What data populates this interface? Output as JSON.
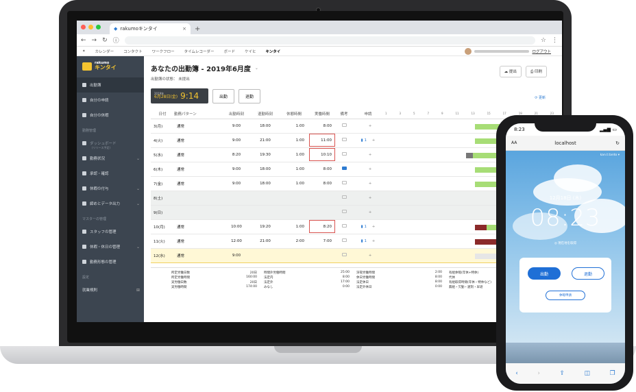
{
  "browser": {
    "tab_title": "rakumoキンタイ",
    "new_tab": "+",
    "tab_close": "×"
  },
  "bookmarks": {
    "items": [
      "カレンダー",
      "コンタクト",
      "ワークフロー",
      "タイムレコーダー",
      "ボード",
      "ケイヒ",
      "キンタイ"
    ],
    "logout": "ログアウト"
  },
  "sidebar": {
    "logo_top": "rakumo",
    "logo_main": "キンタイ",
    "items": [
      {
        "label": "出勤簿"
      },
      {
        "label": "自分の申請"
      },
      {
        "label": "自分の休暇"
      }
    ],
    "section_admin": "勤務管理",
    "admin_items": [
      {
        "label": "ダッシュボード"
      },
      {
        "label": "勤務状況"
      },
      {
        "label": "承認・確認"
      },
      {
        "label": "休暇の付与"
      },
      {
        "label": "締めとデータ出力"
      }
    ],
    "dashboard_sub": "(リリース予定)",
    "section_master": "マスターの管理",
    "master_items": [
      {
        "label": "スタッフの管理"
      },
      {
        "label": "休暇・休日の管理"
      },
      {
        "label": "勤務形態の管理"
      }
    ],
    "section_settings": "設定",
    "settings_items": [
      {
        "label": "就業規則"
      }
    ]
  },
  "main": {
    "title": "あなたの出勤簿 - 2019年6月度",
    "status": "出勤簿の状態： 未提出",
    "btn_submit": "提出",
    "btn_print": "印刷",
    "clock_year": "2019年",
    "clock_date": "6月28日(金)",
    "clock_time": "9:14",
    "btn_in": "出勤",
    "btn_out": "退勤",
    "refresh": "更新",
    "columns": [
      "日付",
      "勤務パターン",
      "出勤時刻",
      "退勤時刻",
      "休憩時間",
      "実働時間",
      "備考",
      "申請"
    ],
    "hours": [
      "1",
      "3",
      "5",
      "7",
      "9",
      "11",
      "13",
      "15",
      "17",
      "19",
      "21",
      "23"
    ]
  },
  "rows": [
    {
      "date": "3(月)",
      "pattern": "通常",
      "in": "9:00",
      "out": "18:00",
      "rest": "1:00",
      "work": "8:00",
      "req": ""
    },
    {
      "date": "4(火)",
      "pattern": "通常",
      "in": "9:00",
      "out": "21:00",
      "rest": "1:00",
      "work": "11:00",
      "req": "1"
    },
    {
      "date": "5(水)",
      "pattern": "通常",
      "in": "8:20",
      "out": "19:30",
      "rest": "1:00",
      "work": "10:10",
      "req": ""
    },
    {
      "date": "6(木)",
      "pattern": "通常",
      "in": "9:00",
      "out": "18:00",
      "rest": "1:00",
      "work": "8:00",
      "req": ""
    },
    {
      "date": "7(金)",
      "pattern": "通常",
      "in": "9:00",
      "out": "18:00",
      "rest": "1:00",
      "work": "8:00",
      "req": ""
    },
    {
      "date": "8(土)",
      "pattern": "",
      "in": "",
      "out": "",
      "rest": "",
      "work": "",
      "req": ""
    },
    {
      "date": "9(日)",
      "pattern": "",
      "in": "",
      "out": "",
      "rest": "",
      "work": "",
      "req": ""
    },
    {
      "date": "10(月)",
      "pattern": "通常",
      "in": "10:00",
      "out": "19:20",
      "rest": "1:00",
      "work": "8:20",
      "req": "1"
    },
    {
      "date": "11(火)",
      "pattern": "通常",
      "in": "12:00",
      "out": "21:00",
      "rest": "2:00",
      "work": "7:00",
      "req": "1"
    },
    {
      "date": "12(水)",
      "pattern": "通常",
      "in": "9:00",
      "out": "",
      "rest": "",
      "work": "",
      "req": ""
    }
  ],
  "summary": [
    [
      "所定労働日数",
      "20日"
    ],
    [
      "時間外労働時間",
      "25:00"
    ],
    [
      "深夜労働時間",
      "2:00"
    ],
    [
      "有給休暇(年休+特休)",
      ""
    ],
    [
      "所定労働時間",
      "160:00"
    ],
    [
      "法定内",
      "8:00"
    ],
    [
      "休日労働時間",
      "8:00"
    ],
    [
      "代休",
      ""
    ],
    [
      "実労働日数",
      "20日"
    ],
    [
      "法定外",
      "17:00"
    ],
    [
      "法定休日",
      "8:00"
    ],
    [
      "有給取得時間(年休・特休など)",
      ""
    ],
    [
      "実労働時間",
      "174:00"
    ],
    [
      "みなし",
      "0:00"
    ],
    [
      "法定外休日",
      "0:00"
    ],
    [
      "無給・欠勤・遅刻・早退",
      ""
    ]
  ],
  "phone": {
    "status_time": "8:23",
    "aa": "AA",
    "url": "localhost",
    "user": "kan.t.tanto ▾",
    "date": "12月18日 (木)",
    "time": "08:23",
    "location": "◎ 現在地を取得",
    "btn_in": "出勤",
    "btn_out": "退勤",
    "btn_leave": "休暇申請"
  }
}
